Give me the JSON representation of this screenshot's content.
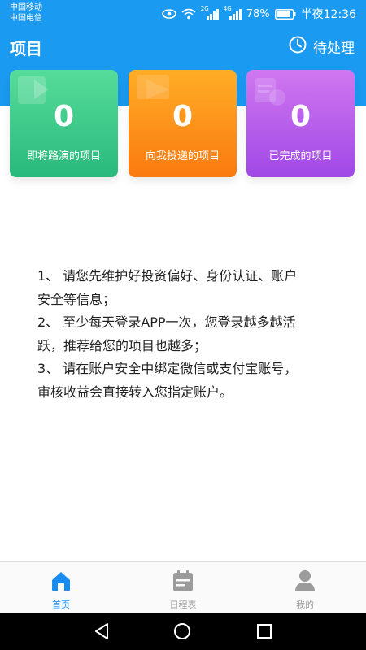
{
  "status_bar": {
    "carrier1": "中国移动",
    "carrier2": "中国电信",
    "battery": "78%",
    "time": "半夜12:36",
    "signal1_label": "2G",
    "signal2_label": "4G"
  },
  "header": {
    "title": "项目",
    "pending_label": "待处理"
  },
  "cards": [
    {
      "value": "0",
      "label": "即将路演的项目",
      "color": "#3cc98a"
    },
    {
      "value": "0",
      "label": "向我投递的项目",
      "color": "#fd8d18"
    },
    {
      "value": "0",
      "label": "已完成的项目",
      "color": "#b75eeb"
    }
  ],
  "info_lines": [
    "1、 请您先维护好投资偏好、身份认证、账户",
    "安全等信息；",
    "2、 至少每天登录APP一次，您登录越多越活",
    "跃，推荐给您的项目也越多；",
    "3、 请在账户安全中绑定微信或支付宝账号，",
    "审核收益会直接转入您指定账户。"
  ],
  "tabbar": {
    "items": [
      {
        "label": "首页",
        "icon": "home-icon",
        "active": true
      },
      {
        "label": "日程表",
        "icon": "calendar-icon",
        "active": false
      },
      {
        "label": "我的",
        "icon": "person-icon",
        "active": false
      }
    ]
  },
  "colors": {
    "primary": "#1a9af0",
    "tab_active": "#1a8cf0",
    "tab_inactive": "#9b9b9b"
  }
}
